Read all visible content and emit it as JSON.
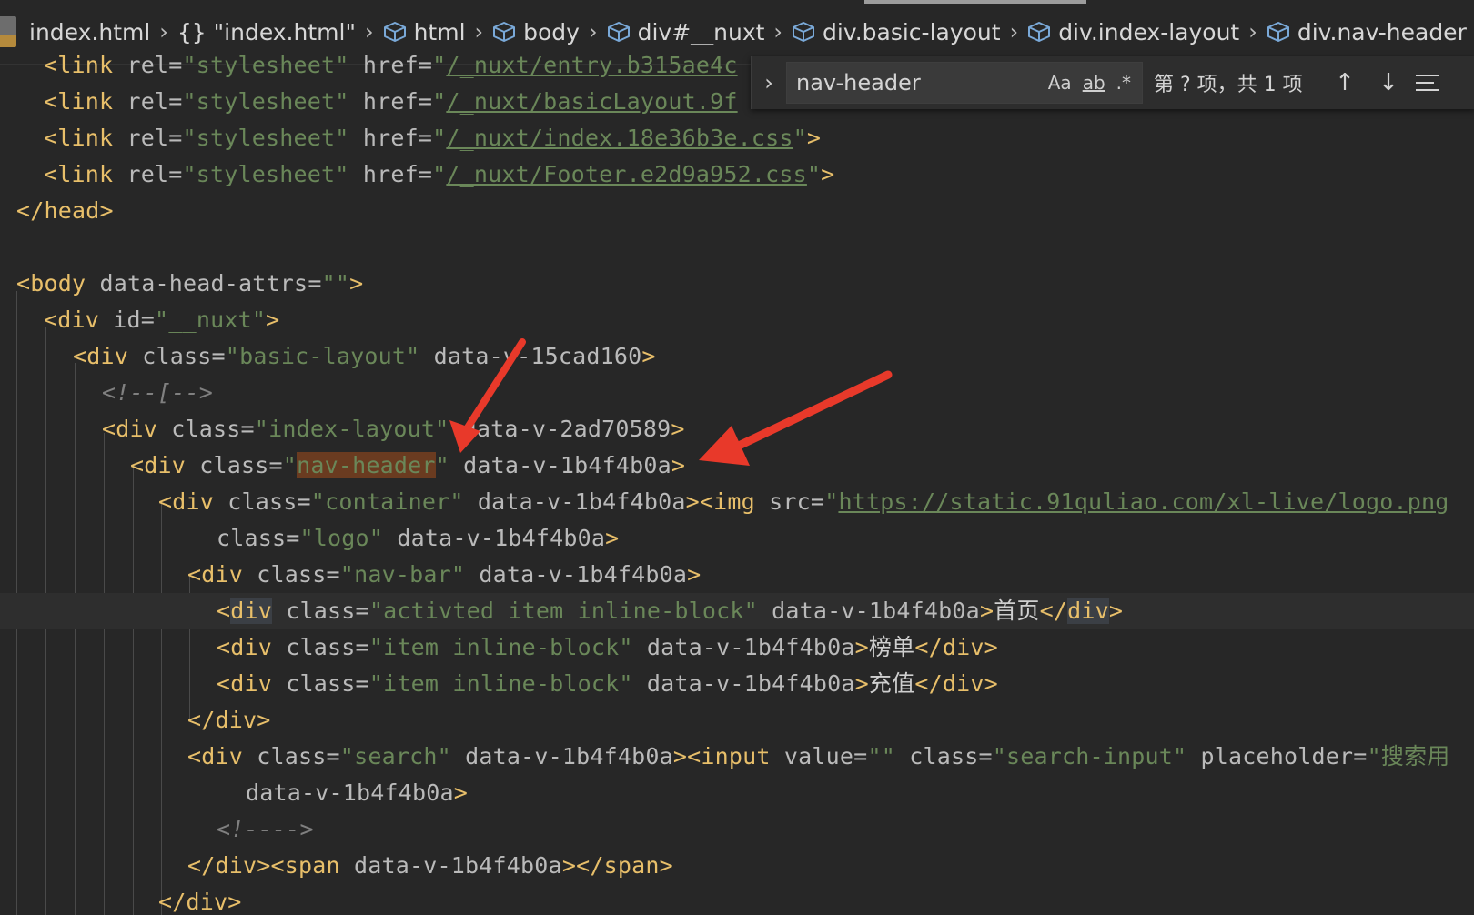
{
  "breadcrumb": {
    "items": [
      {
        "label": "index.html"
      },
      {
        "label": "{} \"index.html\""
      },
      {
        "label": "html"
      },
      {
        "label": "body"
      },
      {
        "label": "div#__nuxt"
      },
      {
        "label": "div.basic-layout"
      },
      {
        "label": "div.index-layout"
      },
      {
        "label": "div.nav-header"
      }
    ]
  },
  "find": {
    "query": "nav-header",
    "match_case": "Aa",
    "whole_word": "ab",
    "regex": ".*",
    "result": "第 ? 项，共 1 项",
    "prev_icon": "arrow-up-icon",
    "next_icon": "arrow-down-icon",
    "expand_icon": "chevron-right-icon",
    "menu_icon": "lines-icon"
  },
  "code": {
    "l1_href": "/_nuxt/entry.b315ae4c",
    "l2_href": "/_nuxt/basicLayout.9f",
    "l3_href": "/_nuxt/index.18e36b3e.css",
    "l4_href": "/_nuxt/Footer.e2d9a952.css",
    "body_attr": "data-head-attrs",
    "nuxt_id": "__nuxt",
    "basic_layout_class": "basic-layout",
    "basic_layout_v": "data-v-15cad160",
    "comment_open": "<!--[-->",
    "index_layout_class": "index-layout",
    "index_layout_v": "data-v-2ad70589",
    "nav_header_class": "nav-header",
    "v_attr": "data-v-1b4f4b0a",
    "container_class": "container",
    "img_src": "https://static.91quliao.com/xl-live/logo.png",
    "logo_class": "logo",
    "nav_bar_class": "nav-bar",
    "item1_class": "activted item inline-block",
    "item1_text": "首页",
    "item2_class": "item inline-block",
    "item2_text": "榜单",
    "item3_class": "item inline-block",
    "item3_text": "充值",
    "search_class": "search",
    "search_input_class": "search-input",
    "placeholder_partial": "搜索用",
    "comment_close": "<!---->"
  },
  "colors": {
    "background": "#272727",
    "tag": "#e8bf6a",
    "string": "#6a8759",
    "attribute": "#bababa",
    "search_highlight": "#6a3b20",
    "arrow": "#e8392a"
  }
}
